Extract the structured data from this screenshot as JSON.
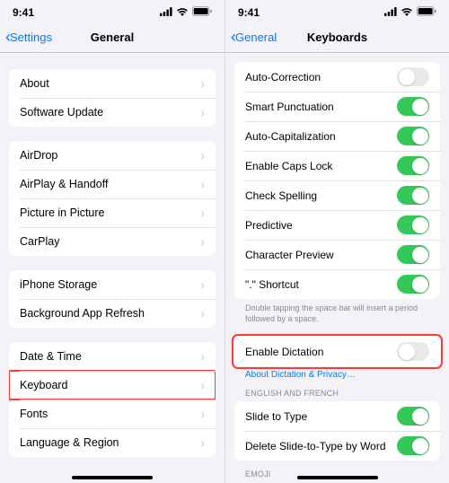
{
  "status": {
    "time": "9:41"
  },
  "left": {
    "back": "Settings",
    "title": "General",
    "groups": [
      {
        "rows": [
          {
            "label": "About"
          },
          {
            "label": "Software Update"
          }
        ]
      },
      {
        "rows": [
          {
            "label": "AirDrop"
          },
          {
            "label": "AirPlay & Handoff"
          },
          {
            "label": "Picture in Picture"
          },
          {
            "label": "CarPlay"
          }
        ]
      },
      {
        "rows": [
          {
            "label": "iPhone Storage"
          },
          {
            "label": "Background App Refresh"
          }
        ]
      },
      {
        "rows": [
          {
            "label": "Date & Time"
          },
          {
            "label": "Keyboard"
          },
          {
            "label": "Fonts"
          },
          {
            "label": "Language & Region"
          }
        ]
      }
    ]
  },
  "right": {
    "back": "General",
    "title": "Keyboards",
    "toggles1": [
      {
        "label": "Auto-Correction",
        "on": false
      },
      {
        "label": "Smart Punctuation",
        "on": true
      },
      {
        "label": "Auto-Capitalization",
        "on": true
      },
      {
        "label": "Enable Caps Lock",
        "on": true
      },
      {
        "label": "Check Spelling",
        "on": true
      },
      {
        "label": "Predictive",
        "on": true
      },
      {
        "label": "Character Preview",
        "on": true
      },
      {
        "label": "\".\" Shortcut",
        "on": true
      }
    ],
    "note1": "Double tapping the space bar will insert a period followed by a space.",
    "dictation": {
      "label": "Enable Dictation",
      "on": false
    },
    "privacy_link": "About Dictation & Privacy…",
    "section_english": "ENGLISH AND FRENCH",
    "toggles2": [
      {
        "label": "Slide to Type",
        "on": true
      },
      {
        "label": "Delete Slide-to-Type by Word",
        "on": true
      }
    ],
    "section_emoji": "EMOJI"
  }
}
